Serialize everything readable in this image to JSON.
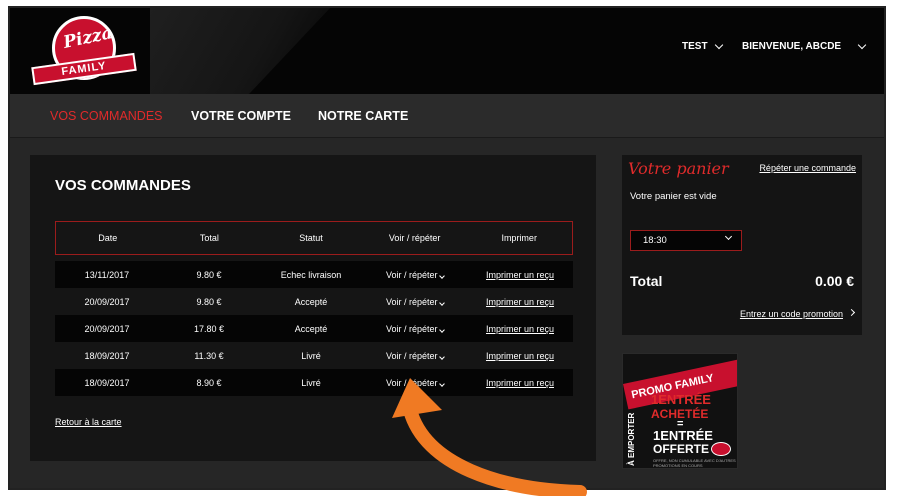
{
  "header": {
    "logo_script": "Pizza",
    "logo_ribbon": "FAMILY",
    "menu_test": "TEST",
    "menu_welcome": "BIENVENUE, ABCDE"
  },
  "nav": {
    "items": [
      "VOS COMMANDES",
      "VOTRE COMPTE",
      "NOTRE CARTE"
    ]
  },
  "orders": {
    "title": "VOS COMMANDES",
    "columns": [
      "Date",
      "Total",
      "Statut",
      "Voir / répéter",
      "Imprimer"
    ],
    "rows": [
      {
        "date": "13/11/2017",
        "total": "9.80 €",
        "status": "Echec livraison",
        "view": "Voir / répéter",
        "print": "Imprimer un reçu"
      },
      {
        "date": "20/09/2017",
        "total": "9.80 €",
        "status": "Accepté",
        "view": "Voir / répéter",
        "print": "Imprimer un reçu"
      },
      {
        "date": "20/09/2017",
        "total": "17.80 €",
        "status": "Accepté",
        "view": "Voir / répéter",
        "print": "Imprimer un reçu"
      },
      {
        "date": "18/09/2017",
        "total": "11.30 €",
        "status": "Livré",
        "view": "Voir / répéter",
        "print": "Imprimer un reçu"
      },
      {
        "date": "18/09/2017",
        "total": "8.90 €",
        "status": "Livré",
        "view": "Voir / répéter",
        "print": "Imprimer un reçu"
      }
    ],
    "back_link": "Retour à la carte"
  },
  "cart": {
    "title": "Votre panier",
    "repeat_link": "Répéter une commande",
    "empty_text": "Votre panier est vide",
    "time_value": "18:30",
    "total_label": "Total",
    "total_value": "0.00 €",
    "promo_link": "Entrez un code promotion"
  },
  "promo": {
    "banner": "PROMO FAMILY",
    "side": "À EMPORTER",
    "line1": "1ENTRÉE",
    "line2": "ACHETÉE",
    "line3": "=",
    "line4": "1ENTRÉE",
    "line5": "OFFERTE",
    "fine": "OFFRE, NON CUMULABLE AVEC D'AUTRES PROMOTIONS EN COURS"
  },
  "colors": {
    "accent": "#e02b2b",
    "arrow": "#f07a23"
  }
}
